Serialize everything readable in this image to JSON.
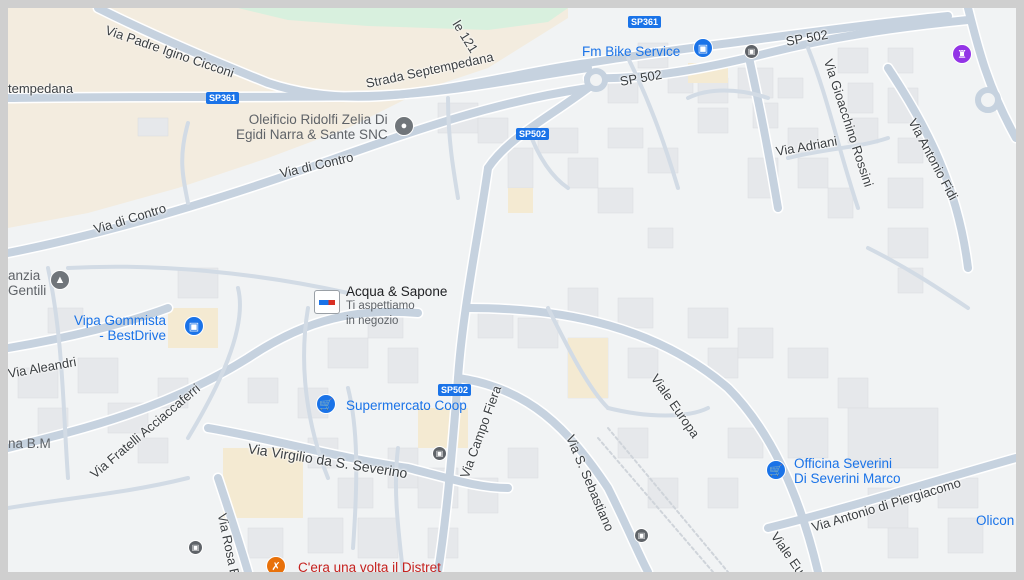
{
  "colors": {
    "frame": "#cfcfcf",
    "land": "#f1f3f4",
    "rural": "#f3ecdf",
    "park": "#d8f0de",
    "road": "#c6d2df",
    "road_edge": "#ffffff",
    "building": "#e6e8eb",
    "poi_blue": "#1a73e8",
    "poi_text_gray": "#5f6368"
  },
  "roads": [
    "Via Padre Igino Cicconi",
    "Strada Septempedana",
    "tempedana",
    "Via di Contro",
    "Via di Contro",
    "Via Gioacchino Rossini",
    "Via Adriani",
    "Via Antonio Fidi",
    "SP 502",
    "SP 502",
    "le 121",
    "Viale Europa",
    "Viale Europa",
    "Via Antonio di Piergiacomo",
    "Via S. Sebastiano",
    "Via Campo Fiera",
    "Via Virgilio da S. Severino",
    "Via Fratelli Acciaccaferri",
    "Via Aleandri",
    "Via Rosa E"
  ],
  "shields": [
    "SP361",
    "SP361",
    "SP502",
    "SP502"
  ],
  "places": {
    "bike": "Fm Bike Service",
    "oleificio_1": "Oleificio Ridolfi Zelia Di",
    "oleificio_2": "Egidi Narra & Sante SNC",
    "acqua_title": "Acqua & Sapone",
    "acqua_sub1": "Ti aspettiamo",
    "acqua_sub2": "in negozio",
    "vipa_1": "Vipa Gommista",
    "vipa_2": "- BestDrive",
    "coop": "Supermercato Coop",
    "officina_1": "Officina Severini",
    "officina_2": "Di Severini Marco",
    "olicon": "Olicon",
    "stanzia_1": "anzia",
    "stanzia_2": "Gentili",
    "bm": "na B.M",
    "restaurant": "C'era una volta il Distret"
  },
  "icons": {
    "bike": "shopping-bag-icon",
    "oleificio": "place-dot-icon",
    "vipa": "car-repair-icon",
    "coop": "shopping-cart-icon",
    "officina": "shopping-cart-icon",
    "school": "school-icon",
    "landmark": "landmark-icon",
    "restaurant": "restaurant-icon",
    "bus": "bus-stop-icon"
  }
}
